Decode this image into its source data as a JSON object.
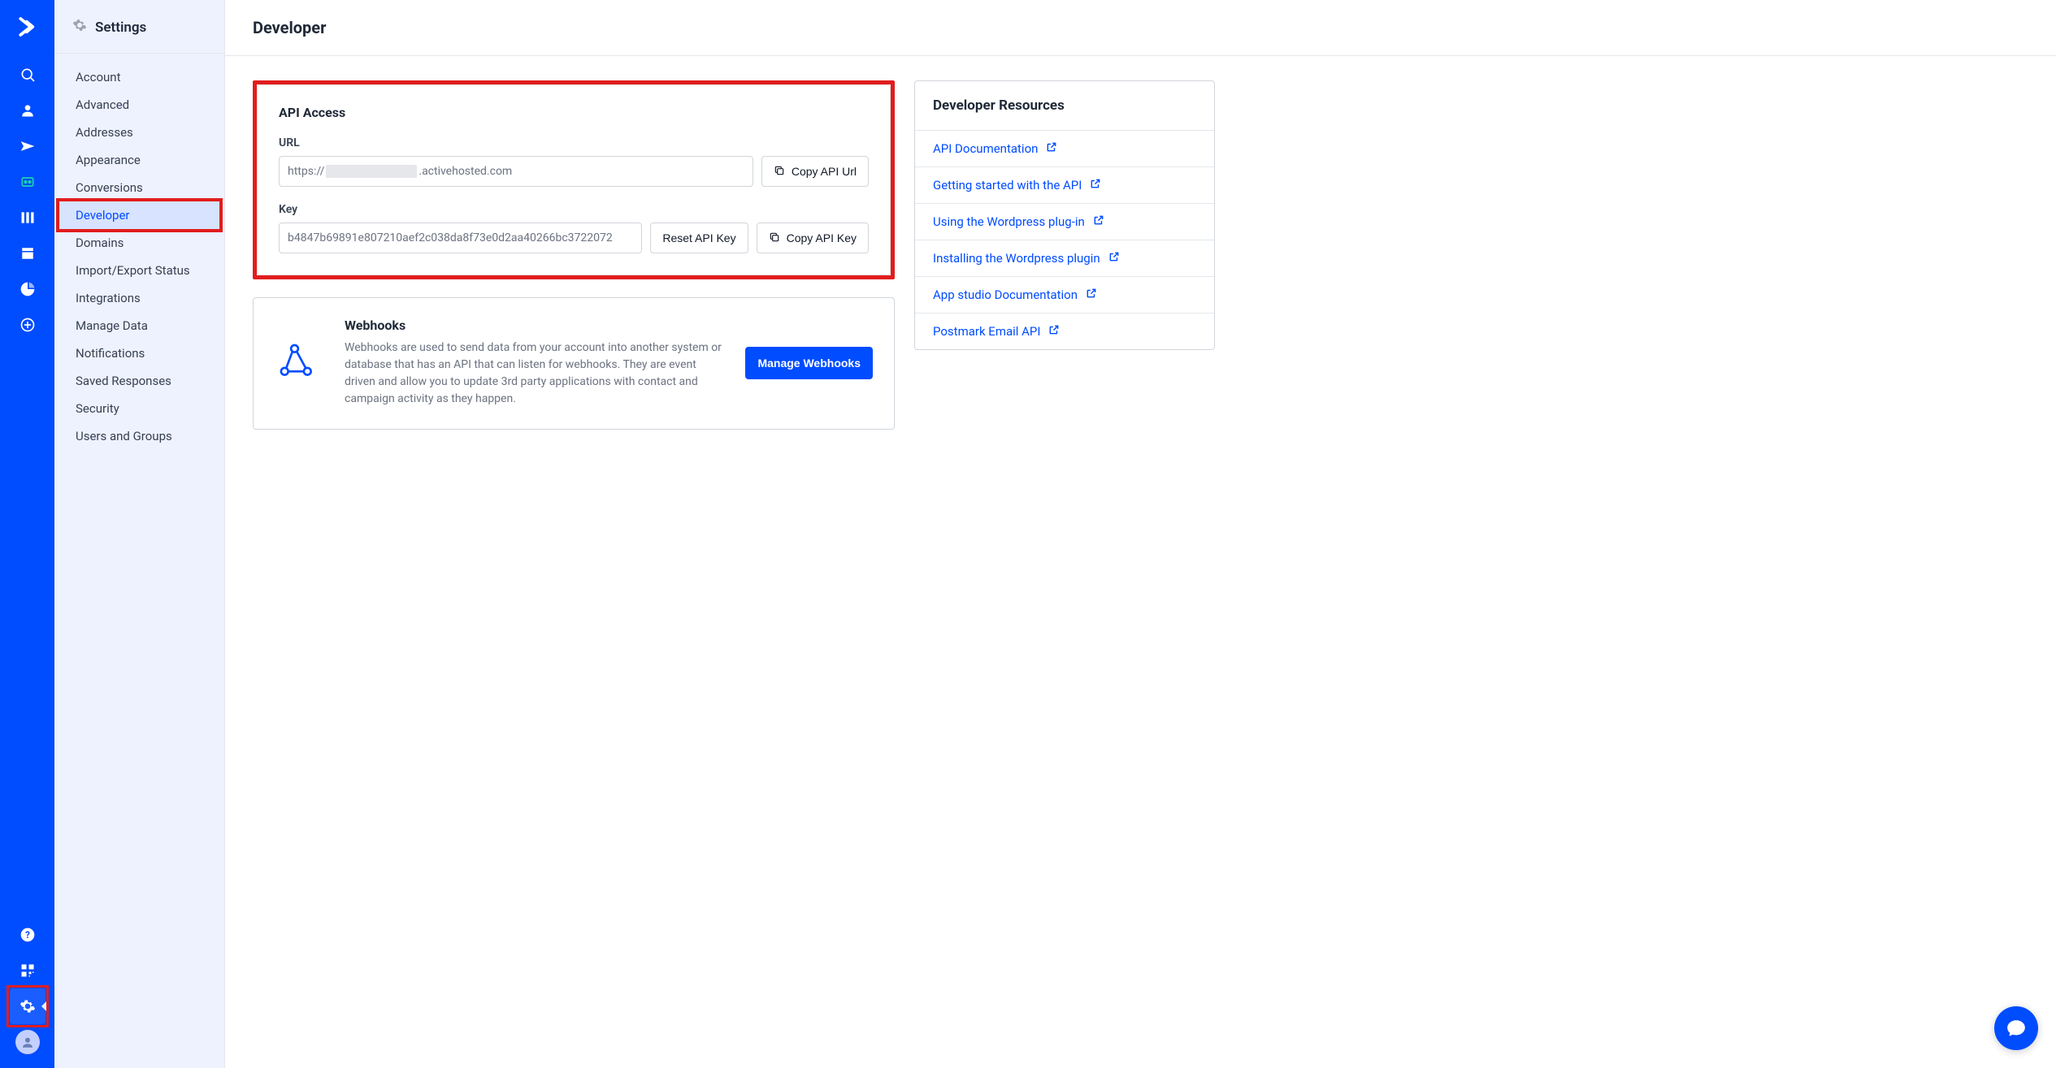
{
  "sidebar": {
    "title": "Settings",
    "items": [
      {
        "label": "Account"
      },
      {
        "label": "Advanced"
      },
      {
        "label": "Addresses"
      },
      {
        "label": "Appearance"
      },
      {
        "label": "Conversions"
      },
      {
        "label": "Developer"
      },
      {
        "label": "Domains"
      },
      {
        "label": "Import/Export Status"
      },
      {
        "label": "Integrations"
      },
      {
        "label": "Manage Data"
      },
      {
        "label": "Notifications"
      },
      {
        "label": "Saved Responses"
      },
      {
        "label": "Security"
      },
      {
        "label": "Users and Groups"
      }
    ]
  },
  "page": {
    "title": "Developer"
  },
  "api": {
    "section_title": "API Access",
    "url_label": "URL",
    "url_prefix": "https://",
    "url_suffix": ".activehosted.com",
    "copy_url_label": "Copy API Url",
    "key_label": "Key",
    "key_value": "b4847b69891e807210aef2c038da8f73e0d2aa40266bc3722072",
    "reset_key_label": "Reset API Key",
    "copy_key_label": "Copy API Key"
  },
  "webhooks": {
    "title": "Webhooks",
    "desc": "Webhooks are used to send data from your account into another system or database that has an API that can listen for webhooks. They are event driven and allow you to update 3rd party applications with contact and campaign activity as they happen.",
    "manage_label": "Manage Webhooks"
  },
  "resources": {
    "title": "Developer Resources",
    "items": [
      {
        "label": "API Documentation"
      },
      {
        "label": "Getting started with the API"
      },
      {
        "label": "Using the Wordpress plug-in"
      },
      {
        "label": "Installing the Wordpress plugin"
      },
      {
        "label": "App studio Documentation"
      },
      {
        "label": "Postmark Email API"
      }
    ]
  }
}
